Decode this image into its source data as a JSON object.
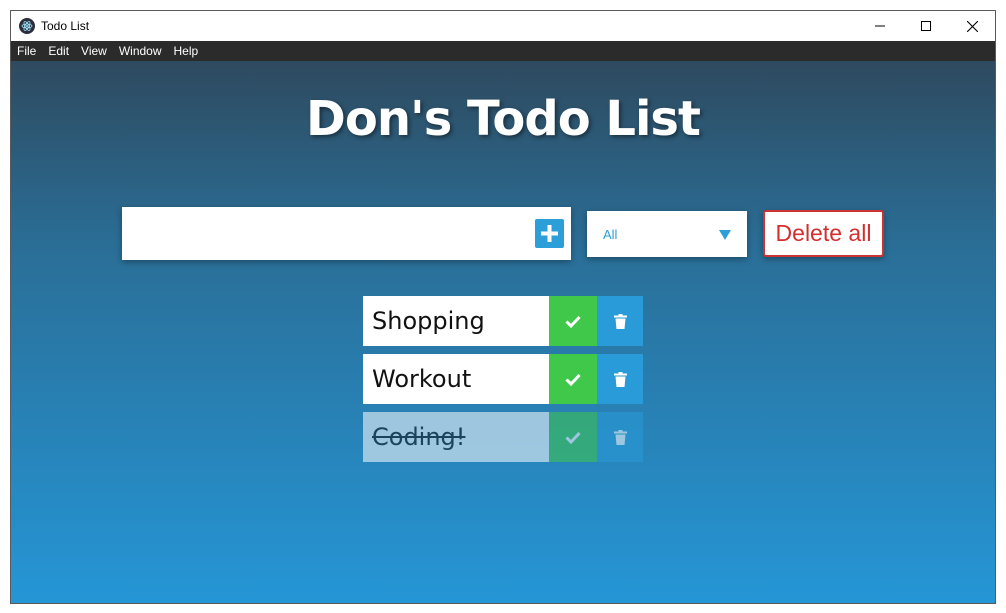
{
  "window": {
    "title": "Todo List",
    "app_icon": "electron-atom-icon",
    "controls": [
      "minimize-icon",
      "maximize-icon",
      "close-icon"
    ]
  },
  "menubar": {
    "items": [
      "File",
      "Edit",
      "View",
      "Window",
      "Help"
    ]
  },
  "main": {
    "title": "Don's Todo List",
    "input": {
      "value": "",
      "placeholder": ""
    },
    "add_button_icon": "plus-square-icon",
    "filter": {
      "selected": "All",
      "arrow_icon": "triangle-down-icon"
    },
    "delete_all_label": "Delete all",
    "todos": [
      {
        "text": "Shopping",
        "completed": false
      },
      {
        "text": "Workout",
        "completed": false
      },
      {
        "text": "Coding!",
        "completed": true
      }
    ],
    "item_icons": {
      "check": "check-icon",
      "delete": "trash-icon"
    }
  },
  "colors": {
    "accent": "#2d9fd8",
    "check_green": "#3fc84a",
    "delete_red": "#d32f2f",
    "gradient_top": "#2e4a5f",
    "gradient_bottom": "#2596d6"
  }
}
